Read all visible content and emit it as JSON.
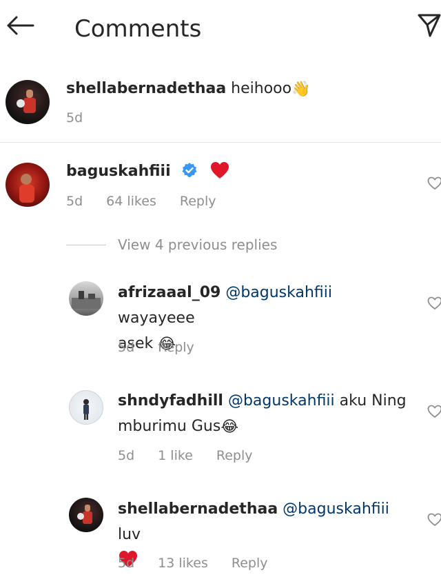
{
  "header": {
    "title": "Comments",
    "back_icon": "arrow-left-icon",
    "share_icon": "paper-plane-icon"
  },
  "caption": {
    "username": "shellabernadethaa",
    "text": " heihooo",
    "emoji": "👋",
    "time": "5d"
  },
  "comment": {
    "username": "baguskahfiii",
    "verified": true,
    "text_emoji": "❤️",
    "time": "5d",
    "likes": "64 likes",
    "reply_label": "Reply"
  },
  "view_replies": "View 4 previous replies",
  "replies": [
    {
      "username": "afrizaaal_09",
      "mention": "@baguskahfiii",
      "text_line1": " wayayeee",
      "text_line2": "asek ",
      "emoji": "😂",
      "time": "5d",
      "likes": "",
      "reply_label": "Reply"
    },
    {
      "username": "shndyfadhill",
      "mention": "@baguskahfiii",
      "text_line1": " aku Ning",
      "text_line2": "mburimu Gus",
      "emoji": "😂",
      "time": "5d",
      "likes": "1 like",
      "reply_label": "Reply"
    },
    {
      "username": "shellabernadethaa",
      "mention": "@baguskahfiii",
      "text_line1": " luv",
      "time": "5d",
      "likes": "13 likes",
      "reply_label": "Reply"
    }
  ],
  "colors": {
    "mention": "#00376b",
    "meta": "#8e8e8e",
    "verified": "#3897f0",
    "heart": "#ed4956"
  }
}
